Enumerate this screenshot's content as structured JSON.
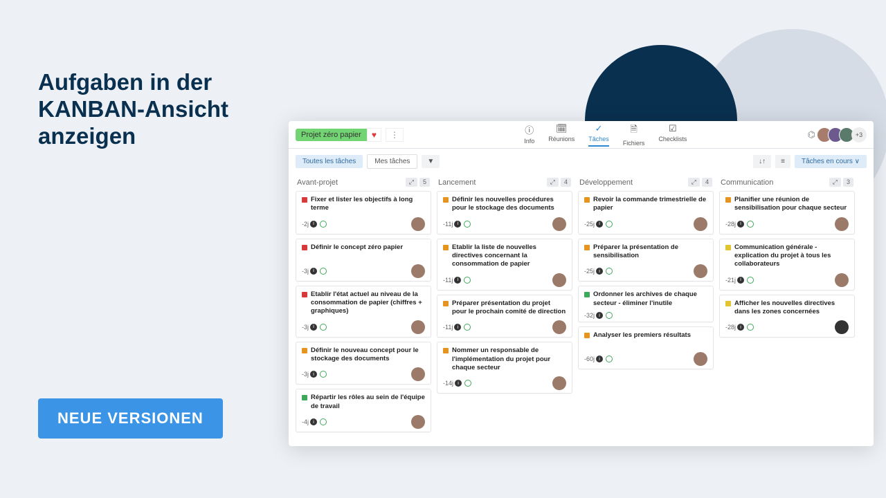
{
  "headline": "Aufgaben in der KANBAN-Ansicht anzeigen",
  "cta": "NEUE VERSIONEN",
  "project_name": "Projet zéro papier",
  "avatars_more": "+3",
  "tabs": {
    "info": "Info",
    "reunions": "Réunions",
    "taches": "Tâches",
    "fichiers": "Fichiers",
    "checklists": "Checklists"
  },
  "filters": {
    "all": "Toutes les tâches",
    "mine": "Mes tâches",
    "status": "Tâches en cours ∨",
    "sort_ico": "↓↑",
    "list_ico": "≡",
    "filter_ico": "▼"
  },
  "columns": [
    {
      "title": "Avant-projet",
      "count": "5",
      "cards": [
        {
          "tag": "red",
          "title": "Fixer et lister les objectifs à long terme",
          "days": "-2j",
          "av": "a"
        },
        {
          "tag": "red",
          "title": "Définir le concept zéro papier",
          "days": "-3j",
          "av": "a"
        },
        {
          "tag": "red",
          "title": "Etablir l'état actuel au niveau de la consommation de papier (chiffres + graphiques)",
          "days": "-3j",
          "av": "a"
        },
        {
          "tag": "orange",
          "title": "Définir le nouveau concept pour le stockage des documents",
          "days": "-3j",
          "av": "a"
        },
        {
          "tag": "green",
          "title": "Répartir les rôles au sein de l'équipe de travail",
          "days": "-4j",
          "av": "a"
        }
      ]
    },
    {
      "title": "Lancement",
      "count": "4",
      "cards": [
        {
          "tag": "orange",
          "title": "Définir les nouvelles procédures pour le stockage des documents",
          "days": "-11j",
          "av": "a"
        },
        {
          "tag": "orange",
          "title": "Etablir la liste de nouvelles directives concernant la consommation de papier",
          "days": "-11j",
          "av": "a"
        },
        {
          "tag": "orange",
          "title": "Préparer présentation du projet pour le prochain comité de direction",
          "days": "-11j",
          "av": "a"
        },
        {
          "tag": "orange",
          "title": "Nommer un responsable de l'implémentation du projet pour chaque secteur",
          "days": "-14j",
          "av": "a"
        }
      ]
    },
    {
      "title": "Développement",
      "count": "4",
      "cards": [
        {
          "tag": "orange",
          "title": "Revoir la commande trimestrielle de papier",
          "days": "-25j",
          "av": "a"
        },
        {
          "tag": "orange",
          "title": "Préparer la présentation de sensibilisation",
          "days": "-25j",
          "av": "a"
        },
        {
          "tag": "green",
          "title": "Ordonner les archives de chaque secteur - éliminer l'inutile",
          "days": "-32j",
          "av": ""
        },
        {
          "tag": "orange",
          "title": "Analyser les premiers résultats",
          "days": "-60j",
          "av": "a"
        }
      ]
    },
    {
      "title": "Communication",
      "count": "3",
      "cards": [
        {
          "tag": "orange",
          "title": "Planifier une réunion de sensibilisation pour chaque secteur",
          "days": "-28j",
          "av": "a"
        },
        {
          "tag": "yellow",
          "title": "Communication générale - explication du projet à tous les collaborateurs",
          "days": "-21j",
          "av": "a"
        },
        {
          "tag": "yellow",
          "title": "Afficher les nouvelles directives dans les zones concernées",
          "days": "-28j",
          "av": "b"
        }
      ]
    }
  ]
}
